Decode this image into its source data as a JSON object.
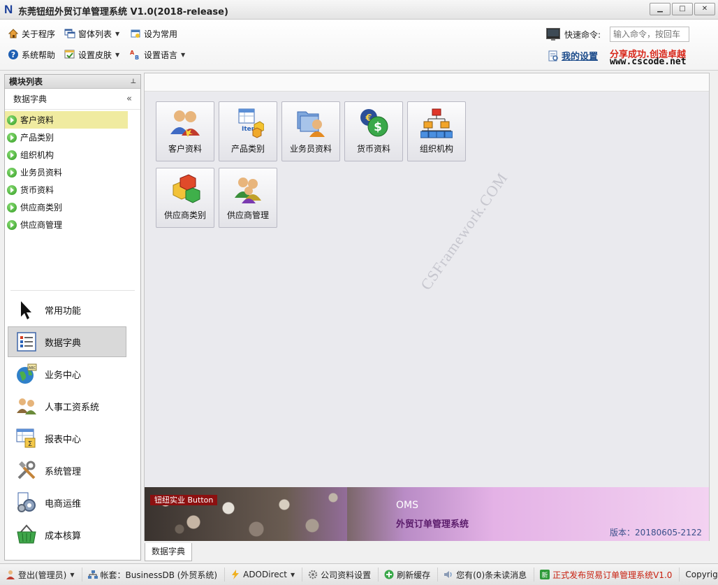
{
  "window": {
    "logo_letter": "N",
    "title": "东莞钮纽外贸订单管理系统 V1.0(2018-release)",
    "buttons": [
      "▁",
      "□",
      "✕"
    ]
  },
  "toolbar": {
    "about": "关于程序",
    "window_list": "窗体列表",
    "set_common": "设为常用",
    "help": "系统帮助",
    "skin": "设置皮肤",
    "language": "设置语言",
    "quick_command_label": "快速命令:",
    "quick_command_placeholder": "输入命令，按回车",
    "my_settings": "我的设置",
    "slogan": "分享成功.创造卓越",
    "website": "www.cscode.net"
  },
  "left_panel": {
    "header": "模块列表",
    "pin_icon": "pin-icon",
    "section": "数据字典",
    "collapse": "«",
    "tree": [
      {
        "label": "客户资料",
        "selected": true
      },
      {
        "label": "产品类别",
        "selected": false
      },
      {
        "label": "组织机构",
        "selected": false
      },
      {
        "label": "业务员资料",
        "selected": false
      },
      {
        "label": "货币资料",
        "selected": false
      },
      {
        "label": "供应商类别",
        "selected": false
      },
      {
        "label": "供应商管理",
        "selected": false
      }
    ],
    "nav": [
      {
        "label": "常用功能",
        "icon": "cursor-icon",
        "active": false
      },
      {
        "label": "数据字典",
        "icon": "list-icon",
        "active": true
      },
      {
        "label": "业务中心",
        "icon": "globe-icon",
        "active": false
      },
      {
        "label": "人事工资系统",
        "icon": "people-icon",
        "active": false
      },
      {
        "label": "报表中心",
        "icon": "report-icon",
        "active": false
      },
      {
        "label": "系统管理",
        "icon": "tools-icon",
        "active": false
      },
      {
        "label": "电商运维",
        "icon": "gears-icon",
        "active": false
      },
      {
        "label": "成本核算",
        "icon": "basket-icon",
        "active": false
      }
    ]
  },
  "main": {
    "tiles": [
      {
        "label": "客户资料",
        "icon": "customers-icon"
      },
      {
        "label": "产品类别",
        "icon": "product-item-icon"
      },
      {
        "label": "业务员资料",
        "icon": "salesman-icon"
      },
      {
        "label": "货币资料",
        "icon": "currency-icon"
      },
      {
        "label": "组织机构",
        "icon": "org-chart-icon"
      },
      {
        "label": "供应商类别",
        "icon": "supplier-category-icon"
      },
      {
        "label": "供应商管理",
        "icon": "supplier-manage-icon"
      }
    ],
    "watermark": "CSFramework.COM",
    "banner": {
      "tagline": "钮纽实业 Button",
      "oms": "OMS",
      "system_name": "外贸订单管理系统",
      "version": "版本：20180605-2122"
    },
    "doc_tab": "数据字典"
  },
  "statusbar": {
    "logout": "登出(管理员)",
    "account": "帐套：BusinessDB (外贸系统)",
    "ado": "ADODirect",
    "company": "公司资料设置",
    "refresh": "刷新缓存",
    "messages": "您有(0)条未读消息",
    "release": "正式发布贸易订单管理系统V1.0",
    "copyright": "Copyrig"
  },
  "colors": {
    "selected_tree_bg": "#f0eba0",
    "brand_red": "#d8281b",
    "link_blue": "#1a4a8a"
  }
}
